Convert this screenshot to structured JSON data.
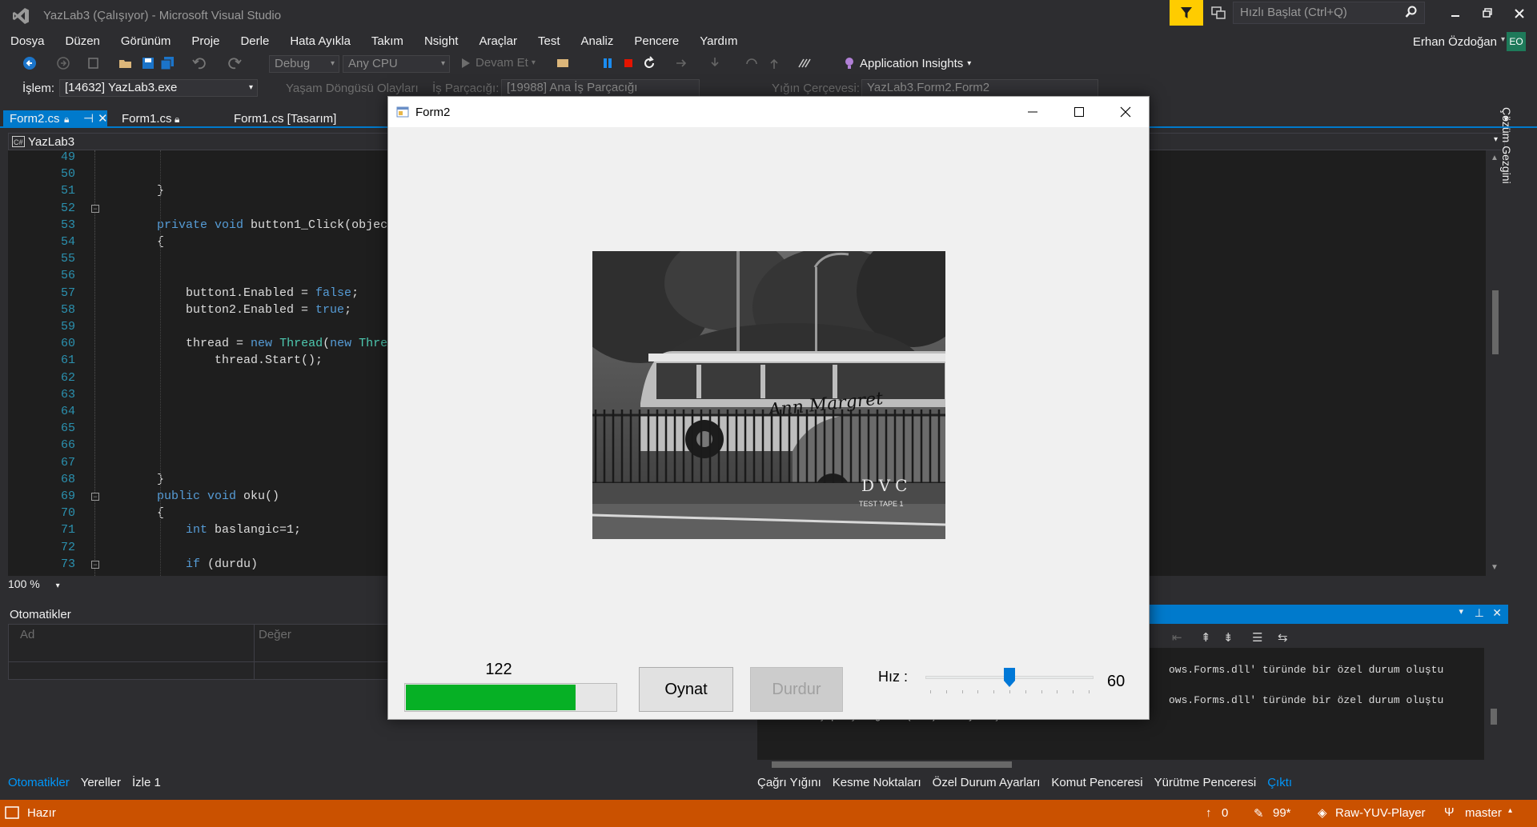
{
  "ide": {
    "title": "YazLab3 (Çalışıyor) - Microsoft Visual Studio",
    "quick_launch_placeholder": "Hızlı Başlat (Ctrl+Q)",
    "account_name": "Erhan Özdoğan",
    "avatar_initials": "EO",
    "menu": [
      "Dosya",
      "Düzen",
      "Görünüm",
      "Proje",
      "Derle",
      "Hata Ayıkla",
      "Takım",
      "Nsight",
      "Araçlar",
      "Test",
      "Analiz",
      "Pencere",
      "Yardım"
    ],
    "toolbar": {
      "config": "Debug",
      "platform": "Any CPU",
      "continue_label": "Devam Et",
      "app_insights": "Application Insights"
    },
    "debug_bar": {
      "process_label": "İşlem:",
      "process_value": "[14632] YazLab3.exe",
      "lifecycle_label": "Yaşam Döngüsü Olayları",
      "thread_label": "İş Parçacığı:",
      "thread_value": "[19988] Ana İş Parçacığı",
      "stackframe_label": "Yığın Çerçevesi:",
      "stackframe_value": "YazLab3.Form2.Form2"
    },
    "tabs": [
      {
        "label": "Form2.cs",
        "active": true
      },
      {
        "label": "Form1.cs",
        "active": false
      },
      {
        "label": "Form1.cs [Tasarım]",
        "active": false
      }
    ],
    "nav_project": "YazLab3",
    "solution_explorer_label": "Çözüm Gezgini",
    "line_numbers": [
      "49",
      "50",
      "51",
      "52",
      "53",
      "54",
      "55",
      "56",
      "57",
      "58",
      "59",
      "60",
      "61",
      "62",
      "63",
      "64",
      "65",
      "66",
      "67",
      "68",
      "69",
      "70",
      "71",
      "72",
      "73"
    ],
    "code_lines": [
      "",
      "}",
      "",
      "private void button1_Click(objec",
      "{",
      "",
      "",
      "    button1.Enabled = false;",
      "    button2.Enabled = true;",
      "",
      "    thread = new Thread(new Thre",
      "        thread.Start();",
      "",
      "",
      "",
      "",
      "",
      "",
      "}",
      "public void oku()",
      "{",
      "    int baslangic=1;",
      "",
      "    if (durdu)"
    ],
    "zoom": "100 %",
    "autos": {
      "title": "Otomatikler",
      "col_name": "Ad",
      "col_value": "Değer"
    },
    "output_lines": [
      "ows.Forms.dll' türünde bir özel durum oluştu",
      "ows.Forms.dll' türünde bir özel durum oluştu",
      "0x12e4 iş parçacığı 0 (0x0) koduyla çıktı."
    ],
    "bottom_tabs_left": [
      "Otomatikler",
      "Yereller",
      "İzle 1"
    ],
    "bottom_tabs_right": [
      "Çağrı Yığını",
      "Kesme Noktaları",
      "Özel Durum Ayarları",
      "Komut Penceresi",
      "Yürütme Penceresi",
      "Çıktı"
    ],
    "status": {
      "ready": "Hazır",
      "up_count": "0",
      "edit_count": "99*",
      "repo": "Raw-YUV-Player",
      "branch": "master"
    }
  },
  "form2": {
    "title": "Form2",
    "frame_counter": "122",
    "progress": 0.81,
    "play_button": "Oynat",
    "stop_button": "Durdur",
    "speed_label": "Hız :",
    "speed_value": "60",
    "slider_level": 0.5,
    "picture_text": [
      "DVC",
      "TEST TAPE 1"
    ],
    "bus_lettering": "Ann Margret"
  },
  "colors": {
    "accent": "#007acc",
    "status_bar": "#ca5100",
    "progress_fill": "#06b025",
    "slider_thumb": "#0078d7"
  }
}
